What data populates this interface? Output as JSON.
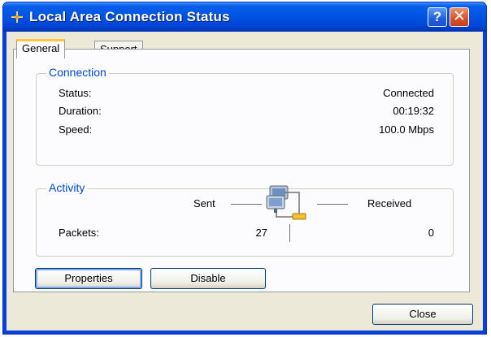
{
  "window": {
    "title": "Local Area Connection Status",
    "title_icon": "network-connection-icon",
    "help_label": "?",
    "close_label": "✕"
  },
  "tabs": [
    {
      "label": "General",
      "active": true
    },
    {
      "label": "Support",
      "active": false
    }
  ],
  "connection": {
    "legend": "Connection",
    "rows": [
      {
        "label": "Status:",
        "value": "Connected"
      },
      {
        "label": "Duration:",
        "value": "00:19:32"
      },
      {
        "label": "Speed:",
        "value": "100.0 Mbps"
      }
    ]
  },
  "activity": {
    "legend": "Activity",
    "sent_label": "Sent",
    "received_label": "Received",
    "packets_label": "Packets:",
    "packets_sent": "27",
    "packets_received": "0",
    "icon": "network-activity-icon"
  },
  "buttons": {
    "properties": "Properties",
    "disable": "Disable",
    "close": "Close"
  },
  "colors": {
    "title_bar": "#0055e5",
    "legend_text": "#0046d5",
    "dialog_face": "#ece9d8",
    "active_tab_accent": "#ffc83c"
  }
}
